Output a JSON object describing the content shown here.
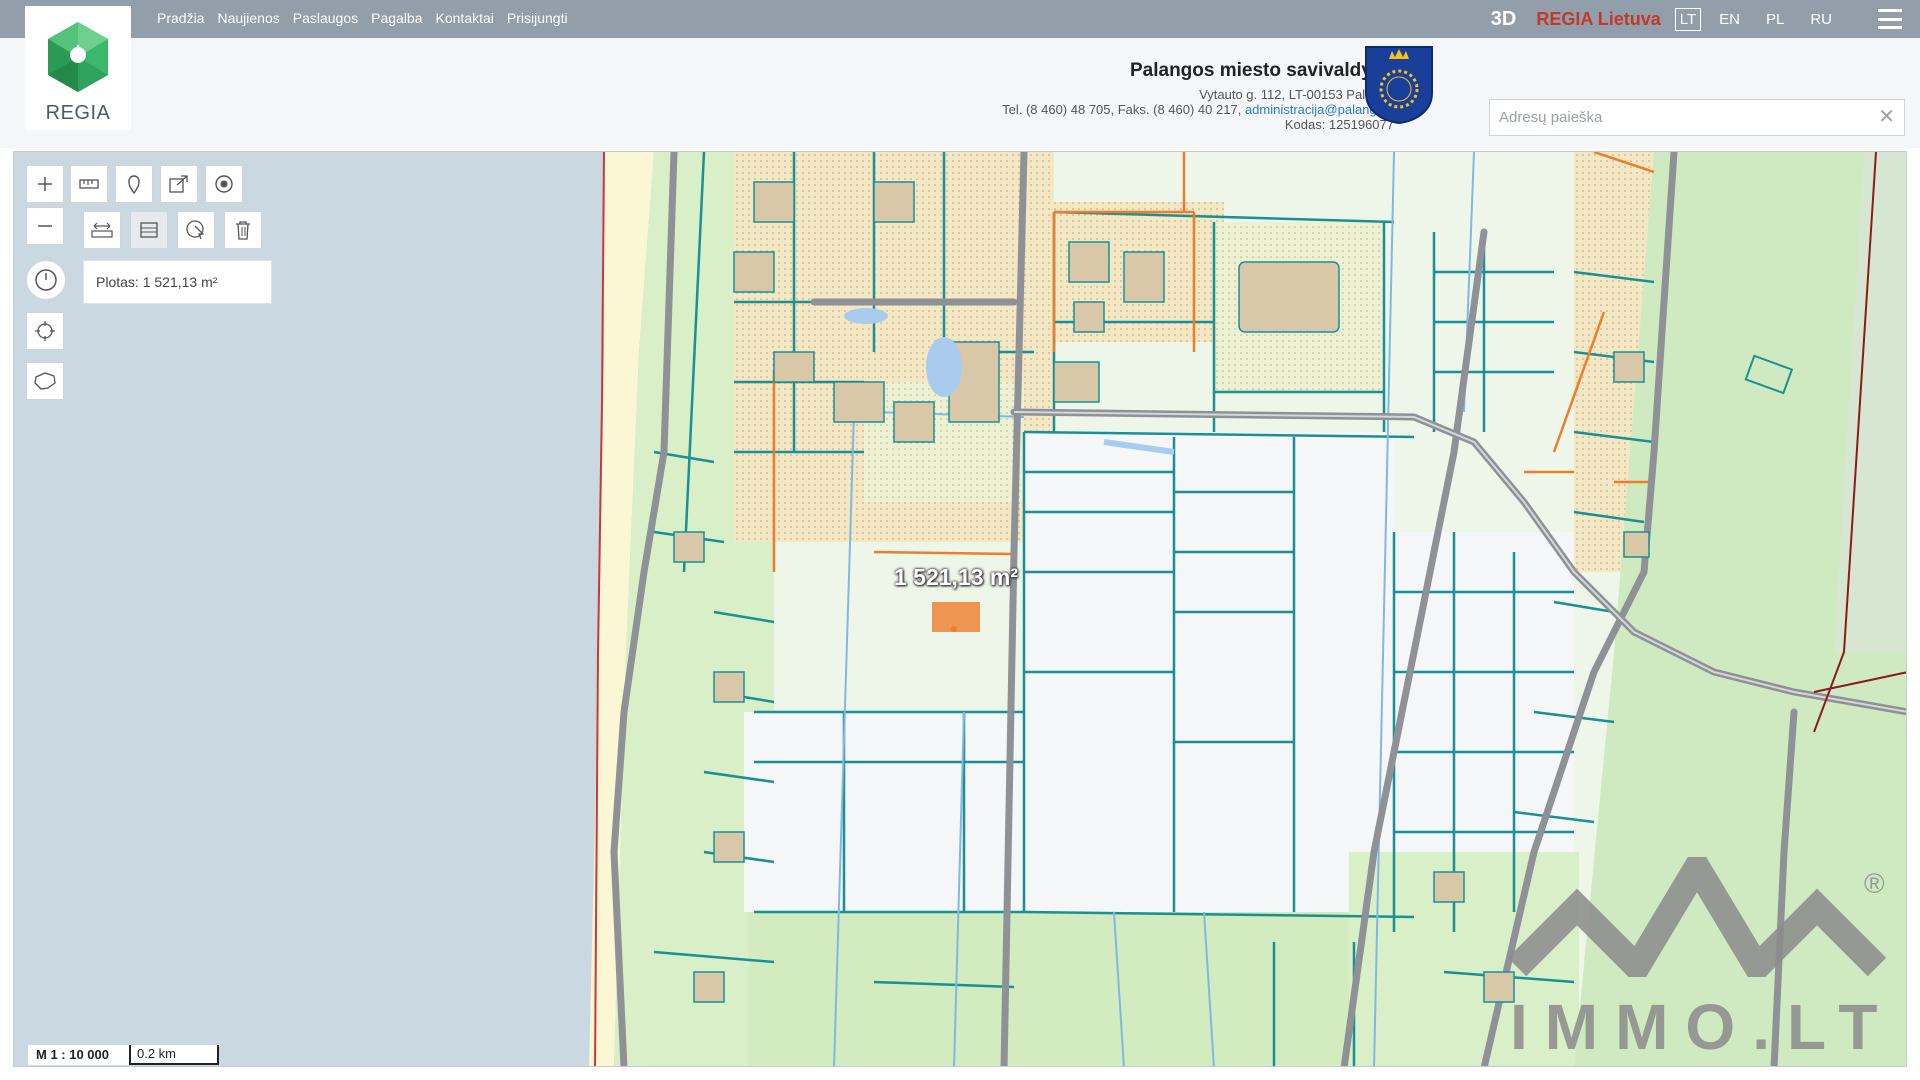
{
  "logo": {
    "text": "REGIA"
  },
  "nav": {
    "items": [
      {
        "label": "Pradžia"
      },
      {
        "label": "Naujienos"
      },
      {
        "label": "Paslaugos"
      },
      {
        "label": "Pagalba"
      },
      {
        "label": "Kontaktai"
      },
      {
        "label": "Prisijungti"
      }
    ]
  },
  "topright": {
    "btn3d": "3D",
    "regia_lietuva": "REGIA Lietuva",
    "languages": [
      {
        "label": "LT",
        "active": true
      },
      {
        "label": "EN",
        "active": false
      },
      {
        "label": "PL",
        "active": false
      },
      {
        "label": "RU",
        "active": false
      }
    ],
    "menu_icon": "hamburger-icon"
  },
  "municipality": {
    "title": "Palangos miesto savivaldybė",
    "address": "Vytauto g. 112, LT-00153 Palanga",
    "phone": "Tel. (8 460) 48 705, Faks. (8 460) 40 217,",
    "email": "administracija@palanga.lt",
    "code": "Kodas: 125196077"
  },
  "search": {
    "placeholder": "Adresų paieška",
    "value": "",
    "clear_icon": "close-icon"
  },
  "map": {
    "area_panel_text": "Plotas: 1 521,13 m²",
    "area_label": "1 521,13 m²",
    "scale_ratio": "M 1 : 10 000",
    "scale_bar": "0.2 km",
    "tools": [
      "zoom-in-icon",
      "zoom-out-icon",
      "ruler-icon",
      "pin-icon",
      "share-icon",
      "target-icon",
      "measure-distance-icon",
      "measure-area-icon",
      "select-icon",
      "delete-icon",
      "history-icon",
      "locate-icon",
      "region-icon"
    ],
    "colors": {
      "water": "#cad8e2",
      "beach": "#fbf6d4",
      "green": "#cfeac0",
      "parcel": "#1a8f94",
      "orange": "#ee7d2b",
      "road": "#8e9296"
    }
  },
  "watermark": {
    "text": "IMMO.LT",
    "reg": "®"
  }
}
